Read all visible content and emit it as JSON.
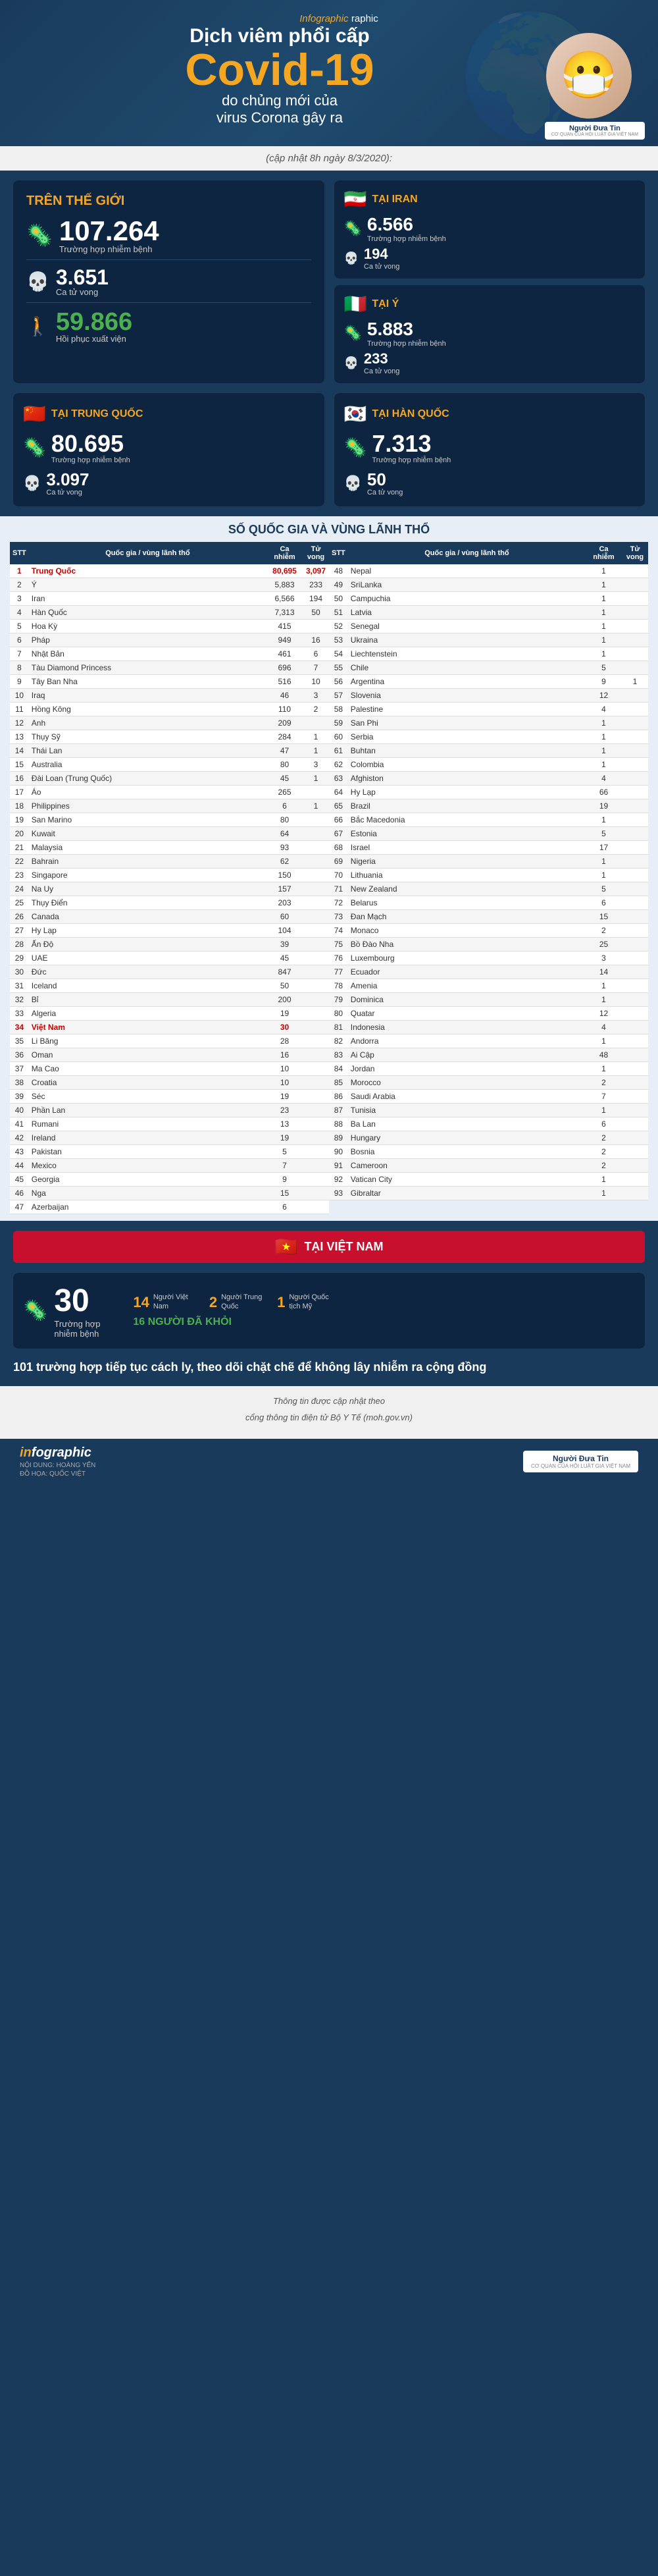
{
  "header": {
    "infographic_label": "Infographic",
    "title_line1": "Dịch viêm phổi cấp",
    "title_big": "Covid-19",
    "subtitle": "do chủng mới của",
    "subtitle2": "virus Corona gây ra",
    "logo_name": "Người Đưa Tin",
    "logo_sub": "CƠ QUAN CỦA HỘI LUẬT GIA VIỆT NAM"
  },
  "update": {
    "text": "(cập nhật 8h ngày 8/3/2020):"
  },
  "world": {
    "title": "TRÊN THẾ GIỚI",
    "cases": "107.264",
    "cases_label": "Trường hợp nhiễm bệnh",
    "deaths": "3.651",
    "deaths_label": "Ca tử vong",
    "recovered": "59.866",
    "recovered_label": "Hồi phục xuất viện"
  },
  "iran": {
    "label": "TẠI IRAN",
    "cases": "6.566",
    "cases_label": "Trường hợp nhiễm bệnh",
    "deaths": "194",
    "deaths_label": "Ca tử vong"
  },
  "italy": {
    "label": "TẠI Ý",
    "cases": "5.883",
    "cases_label": "Trường hợp nhiễm bệnh",
    "deaths": "233",
    "deaths_label": "Ca tử vong"
  },
  "china": {
    "label": "TẠI TRUNG QUỐC",
    "cases": "80.695",
    "cases_label": "Trường hợp nhiễm bệnh",
    "deaths": "3.097",
    "deaths_label": "Ca tử vong"
  },
  "korea": {
    "label": "TẠI HÀN QUỐC",
    "cases": "7.313",
    "cases_label": "Trường hợp nhiễm bệnh",
    "deaths": "50",
    "deaths_label": "Ca tử vong"
  },
  "table": {
    "title": "SỐ QUỐC GIA VÀ VÙNG LÃNH THỔ",
    "headers": [
      "STT",
      "Quốc gia / vùng lãnh thổ",
      "Ca nhiễm",
      "Tử vong"
    ],
    "left_rows": [
      {
        "stt": "1",
        "country": "Trung Quốc",
        "cases": "80,695",
        "deaths": "3,097",
        "highlight": true
      },
      {
        "stt": "2",
        "country": "Ý",
        "cases": "5,883",
        "deaths": "233"
      },
      {
        "stt": "3",
        "country": "Iran",
        "cases": "6,566",
        "deaths": "194"
      },
      {
        "stt": "4",
        "country": "Hàn Quốc",
        "cases": "7,313",
        "deaths": "50"
      },
      {
        "stt": "5",
        "country": "Hoa Kỳ",
        "cases": "415",
        "deaths": ""
      },
      {
        "stt": "6",
        "country": "Pháp",
        "cases": "949",
        "deaths": "16"
      },
      {
        "stt": "7",
        "country": "Nhật Bản",
        "cases": "461",
        "deaths": "6"
      },
      {
        "stt": "8",
        "country": "Tàu Diamond Princess",
        "cases": "696",
        "deaths": "7"
      },
      {
        "stt": "9",
        "country": "Tây Ban Nha",
        "cases": "516",
        "deaths": "10"
      },
      {
        "stt": "10",
        "country": "Iraq",
        "cases": "46",
        "deaths": "3"
      },
      {
        "stt": "11",
        "country": "Hồng Kông",
        "cases": "110",
        "deaths": "2"
      },
      {
        "stt": "12",
        "country": "Anh",
        "cases": "209",
        "deaths": ""
      },
      {
        "stt": "13",
        "country": "Thụy Sỹ",
        "cases": "284",
        "deaths": "1"
      },
      {
        "stt": "14",
        "country": "Thái Lan",
        "cases": "47",
        "deaths": "1"
      },
      {
        "stt": "15",
        "country": "Australia",
        "cases": "80",
        "deaths": "3"
      },
      {
        "stt": "16",
        "country": "Đài Loan (Trung Quốc)",
        "cases": "45",
        "deaths": "1"
      },
      {
        "stt": "17",
        "country": "Áo",
        "cases": "265",
        "deaths": ""
      },
      {
        "stt": "18",
        "country": "Philippines",
        "cases": "6",
        "deaths": "1"
      },
      {
        "stt": "19",
        "country": "San Marino",
        "cases": "80",
        "deaths": ""
      },
      {
        "stt": "20",
        "country": "Kuwait",
        "cases": "64",
        "deaths": ""
      },
      {
        "stt": "21",
        "country": "Malaysia",
        "cases": "93",
        "deaths": ""
      },
      {
        "stt": "22",
        "country": "Bahrain",
        "cases": "62",
        "deaths": ""
      },
      {
        "stt": "23",
        "country": "Singapore",
        "cases": "150",
        "deaths": ""
      },
      {
        "stt": "24",
        "country": "Na Uy",
        "cases": "157",
        "deaths": ""
      },
      {
        "stt": "25",
        "country": "Thụy Điển",
        "cases": "203",
        "deaths": ""
      },
      {
        "stt": "26",
        "country": "Canada",
        "cases": "60",
        "deaths": ""
      },
      {
        "stt": "27",
        "country": "Hy Lạp",
        "cases": "104",
        "deaths": ""
      },
      {
        "stt": "28",
        "country": "Ấn Độ",
        "cases": "39",
        "deaths": ""
      },
      {
        "stt": "29",
        "country": "UAE",
        "cases": "45",
        "deaths": ""
      },
      {
        "stt": "30",
        "country": "Đức",
        "cases": "847",
        "deaths": ""
      },
      {
        "stt": "31",
        "country": "Iceland",
        "cases": "50",
        "deaths": ""
      },
      {
        "stt": "32",
        "country": "Bỉ",
        "cases": "200",
        "deaths": ""
      },
      {
        "stt": "33",
        "country": "Algeria",
        "cases": "19",
        "deaths": ""
      },
      {
        "stt": "34",
        "country": "Việt Nam",
        "cases": "30",
        "deaths": "",
        "highlight": true
      },
      {
        "stt": "35",
        "country": "Li Băng",
        "cases": "28",
        "deaths": ""
      },
      {
        "stt": "36",
        "country": "Oman",
        "cases": "16",
        "deaths": ""
      },
      {
        "stt": "37",
        "country": "Ma Cao",
        "cases": "10",
        "deaths": ""
      },
      {
        "stt": "38",
        "country": "Croatia",
        "cases": "10",
        "deaths": ""
      },
      {
        "stt": "39",
        "country": "Séc",
        "cases": "19",
        "deaths": ""
      },
      {
        "stt": "40",
        "country": "Phần Lan",
        "cases": "23",
        "deaths": ""
      },
      {
        "stt": "41",
        "country": "Rumani",
        "cases": "13",
        "deaths": ""
      },
      {
        "stt": "42",
        "country": "Ireland",
        "cases": "19",
        "deaths": ""
      },
      {
        "stt": "43",
        "country": "Pakistan",
        "cases": "5",
        "deaths": ""
      },
      {
        "stt": "44",
        "country": "Mexico",
        "cases": "7",
        "deaths": ""
      },
      {
        "stt": "45",
        "country": "Georgia",
        "cases": "9",
        "deaths": ""
      },
      {
        "stt": "46",
        "country": "Nga",
        "cases": "15",
        "deaths": ""
      },
      {
        "stt": "47",
        "country": "Azerbaijan",
        "cases": "6",
        "deaths": ""
      }
    ],
    "right_rows": [
      {
        "stt": "48",
        "country": "Nepal",
        "cases": "1",
        "deaths": ""
      },
      {
        "stt": "49",
        "country": "SriLanka",
        "cases": "1",
        "deaths": ""
      },
      {
        "stt": "50",
        "country": "Campuchia",
        "cases": "1",
        "deaths": ""
      },
      {
        "stt": "51",
        "country": "Latvia",
        "cases": "1",
        "deaths": ""
      },
      {
        "stt": "52",
        "country": "Senegal",
        "cases": "1",
        "deaths": ""
      },
      {
        "stt": "53",
        "country": "Ukraina",
        "cases": "1",
        "deaths": ""
      },
      {
        "stt": "54",
        "country": "Liechtenstein",
        "cases": "1",
        "deaths": ""
      },
      {
        "stt": "55",
        "country": "Chile",
        "cases": "5",
        "deaths": ""
      },
      {
        "stt": "56",
        "country": "Argentina",
        "cases": "9",
        "deaths": "1"
      },
      {
        "stt": "57",
        "country": "Slovenia",
        "cases": "12",
        "deaths": ""
      },
      {
        "stt": "58",
        "country": "Palestine",
        "cases": "4",
        "deaths": ""
      },
      {
        "stt": "59",
        "country": "San Phi",
        "cases": "1",
        "deaths": ""
      },
      {
        "stt": "60",
        "country": "Serbia",
        "cases": "1",
        "deaths": ""
      },
      {
        "stt": "61",
        "country": "Buhtan",
        "cases": "1",
        "deaths": ""
      },
      {
        "stt": "62",
        "country": "Colombia",
        "cases": "1",
        "deaths": ""
      },
      {
        "stt": "63",
        "country": "Afghiston",
        "cases": "4",
        "deaths": ""
      },
      {
        "stt": "64",
        "country": "Hy Lạp",
        "cases": "66",
        "deaths": ""
      },
      {
        "stt": "65",
        "country": "Brazil",
        "cases": "19",
        "deaths": ""
      },
      {
        "stt": "66",
        "country": "Bắc Macedonia",
        "cases": "1",
        "deaths": ""
      },
      {
        "stt": "67",
        "country": "Estonia",
        "cases": "5",
        "deaths": ""
      },
      {
        "stt": "68",
        "country": "Israel",
        "cases": "17",
        "deaths": ""
      },
      {
        "stt": "69",
        "country": "Nigeria",
        "cases": "1",
        "deaths": ""
      },
      {
        "stt": "70",
        "country": "Lithuania",
        "cases": "1",
        "deaths": ""
      },
      {
        "stt": "71",
        "country": "New Zealand",
        "cases": "5",
        "deaths": ""
      },
      {
        "stt": "72",
        "country": "Belarus",
        "cases": "6",
        "deaths": ""
      },
      {
        "stt": "73",
        "country": "Đan Mạch",
        "cases": "15",
        "deaths": ""
      },
      {
        "stt": "74",
        "country": "Monaco",
        "cases": "2",
        "deaths": ""
      },
      {
        "stt": "75",
        "country": "Bồ Đào Nha",
        "cases": "25",
        "deaths": ""
      },
      {
        "stt": "76",
        "country": "Luxembourg",
        "cases": "3",
        "deaths": ""
      },
      {
        "stt": "77",
        "country": "Ecuador",
        "cases": "14",
        "deaths": ""
      },
      {
        "stt": "78",
        "country": "Amenia",
        "cases": "1",
        "deaths": ""
      },
      {
        "stt": "79",
        "country": "Dominica",
        "cases": "1",
        "deaths": ""
      },
      {
        "stt": "80",
        "country": "Quatar",
        "cases": "12",
        "deaths": ""
      },
      {
        "stt": "81",
        "country": "Indonesia",
        "cases": "4",
        "deaths": ""
      },
      {
        "stt": "82",
        "country": "Andorra",
        "cases": "1",
        "deaths": ""
      },
      {
        "stt": "83",
        "country": "Ai Cập",
        "cases": "48",
        "deaths": ""
      },
      {
        "stt": "84",
        "country": "Jordan",
        "cases": "1",
        "deaths": ""
      },
      {
        "stt": "85",
        "country": "Morocco",
        "cases": "2",
        "deaths": ""
      },
      {
        "stt": "86",
        "country": "Saudi Arabia",
        "cases": "7",
        "deaths": ""
      },
      {
        "stt": "87",
        "country": "Tunisia",
        "cases": "1",
        "deaths": ""
      },
      {
        "stt": "88",
        "country": "Ba Lan",
        "cases": "6",
        "deaths": ""
      },
      {
        "stt": "89",
        "country": "Hungary",
        "cases": "2",
        "deaths": ""
      },
      {
        "stt": "90",
        "country": "Bosnia",
        "cases": "2",
        "deaths": ""
      },
      {
        "stt": "91",
        "country": "Cameroon",
        "cases": "2",
        "deaths": ""
      },
      {
        "stt": "92",
        "country": "Vatican City",
        "cases": "1",
        "deaths": ""
      },
      {
        "stt": "93",
        "country": "Gibraltar",
        "cases": "1",
        "deaths": ""
      }
    ]
  },
  "vietnam": {
    "section_title": "TẠI VIỆT NAM",
    "cases": "30",
    "cases_label": "Trường hợp nhiễm bệnh",
    "vn_nationals": "14",
    "vn_nationals_label": "Người Việt Nam",
    "cn_nationals": "2",
    "cn_nationals_label": "Người Trung Quốc",
    "us_nationals": "1",
    "us_nationals_label": "Người Quốc tịch Mỹ",
    "recovered": "16 NGƯỜI ĐÃ KHỎI",
    "note": "101 trường hợp tiếp tục cách ly, theo dõi chặt chẽ để không lây nhiễm ra cộng đồng"
  },
  "footer": {
    "note": "Thông tin được cập nhật theo",
    "note2": "cổng thông tin điện tử Bộ Y Tế (moh.gov.vn)",
    "credits_left": "NỘI DUNG: HOÀNG YẾN",
    "credits_right": "ĐỒ HỌA: QUỐC VIỆT",
    "logo": "Người Đưa Tin",
    "logo_sub": "CƠ QUAN CỦA HỘI LUẬT GIA VIỆT NAM",
    "infographic_label": "infographic"
  }
}
